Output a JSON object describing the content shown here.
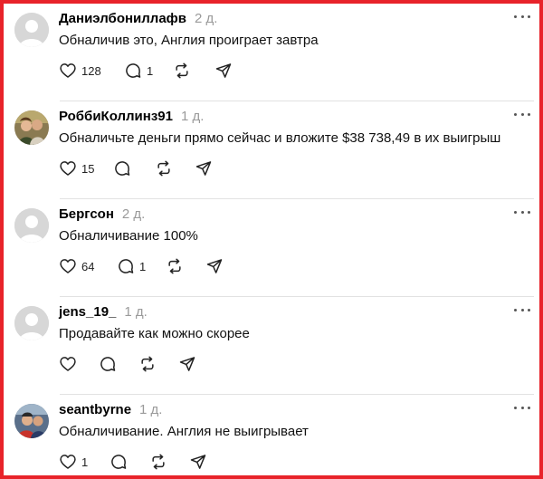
{
  "posts": [
    {
      "username": "Даниэлбониллафв",
      "time": "2 д.",
      "text": "Обналичив это, Англия проиграет завтра",
      "likes": "128",
      "replies": "1",
      "avatar": "default"
    },
    {
      "username": "РоббиКоллинз91",
      "time": "1 д.",
      "text": "Обналичьте деньги прямо сейчас и вложите $38 738,49 в их выигрыш",
      "likes": "15",
      "replies": "",
      "avatar": "photo"
    },
    {
      "username": "Бергсон",
      "time": "2 д.",
      "text": "Обналичивание 100%",
      "likes": "64",
      "replies": "1",
      "avatar": "default"
    },
    {
      "username": "jens_19_",
      "time": "1 д.",
      "text": "Продавайте как можно скорее",
      "likes": "",
      "replies": "",
      "avatar": "default"
    },
    {
      "username": "seantbyrne",
      "time": "1 д.",
      "text": "Обналичивание. Англия не выигрывает",
      "likes": "1",
      "replies": "",
      "avatar": "photo"
    }
  ],
  "icons": {
    "like": "heart-icon",
    "reply": "comment-icon",
    "repost": "repost-icon",
    "share": "send-icon",
    "more": "more-icon"
  },
  "colors": {
    "frame": "#e8232a",
    "time": "#9a9a9a",
    "divider": "#e2e2e2"
  }
}
